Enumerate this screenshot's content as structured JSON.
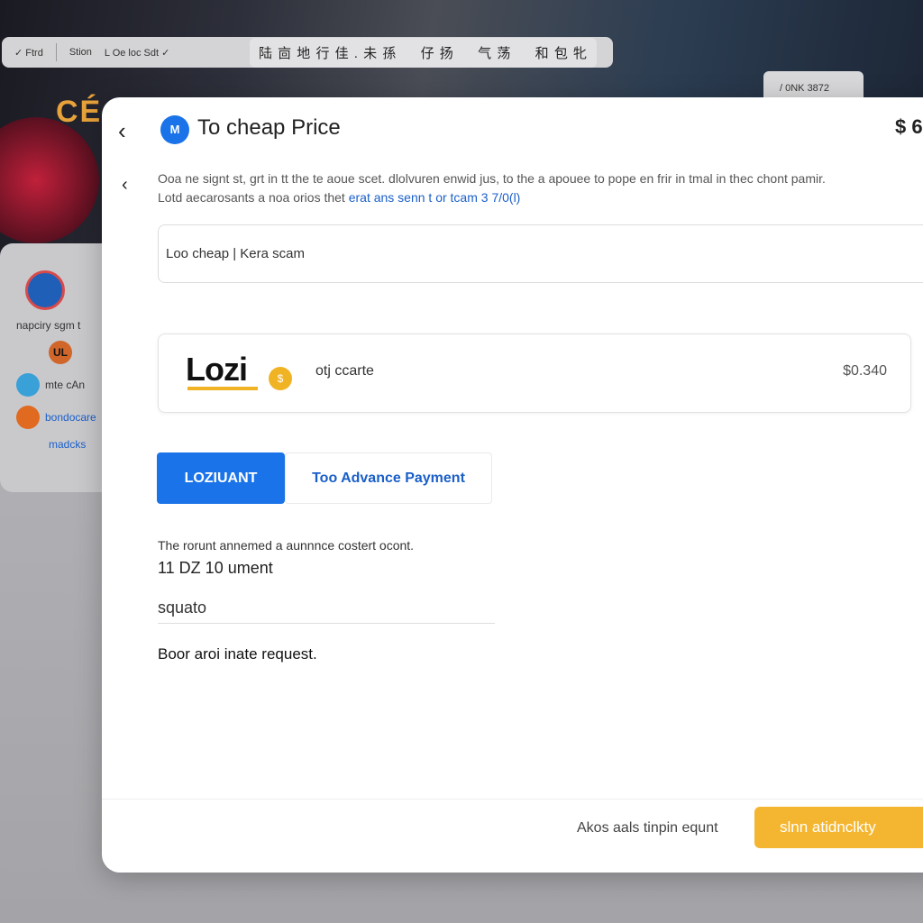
{
  "background": {
    "sign_text": "CÉ",
    "topbar": {
      "items": [
        "✓ Ftrd",
        "Stion",
        "L Oe loc Sdt ✓"
      ],
      "cjk_text": "陆 㐭 地 行 佳 . 未 孫 　 仔 扬 　 气 荡 　 和 包 牝"
    },
    "corner_chip": "/ 0NK 3872",
    "left_panel": {
      "items": [
        "napciry sgm t",
        "UL",
        "mte cAn",
        "bondocare",
        "madcks"
      ]
    }
  },
  "modal": {
    "back_icon": "chevron-left-icon",
    "title_icon_text": "M",
    "title": "To cheap Price",
    "price": "$ 6",
    "info_icon": "arrow-icon",
    "description": "Ooa ne signt st, grt in tt the te aoue scet. dlolvuren enwid jus, to the a apouee to pope en frir in tmal in thec chont pamir. Lotd aecarosants a noa orios thet ",
    "description_link": "erat ans senn t or tcam 3 7/0(l)",
    "search_value": "Loo cheap | Kera scam",
    "option": {
      "logo": "Lozi",
      "coin": "$",
      "label": "otj ccarte",
      "price": "$0.340"
    },
    "tabs": [
      {
        "label": "LOZIUANT",
        "active": true
      },
      {
        "label": "Too Advance Payment",
        "active": false
      }
    ],
    "amount_label": "The rorunt annemed  a aunnnce costert ocont.",
    "amount_value": "11 DZ 10 ument",
    "field_value": "squato",
    "note": "Boor aroi inate request.",
    "footer_text": "Akos aals tinpin equnt",
    "cta_label": "slnn atidnclkty"
  },
  "colors": {
    "accent": "#1a73e8",
    "cta": "#f4b630",
    "link": "#1a5fc9"
  }
}
